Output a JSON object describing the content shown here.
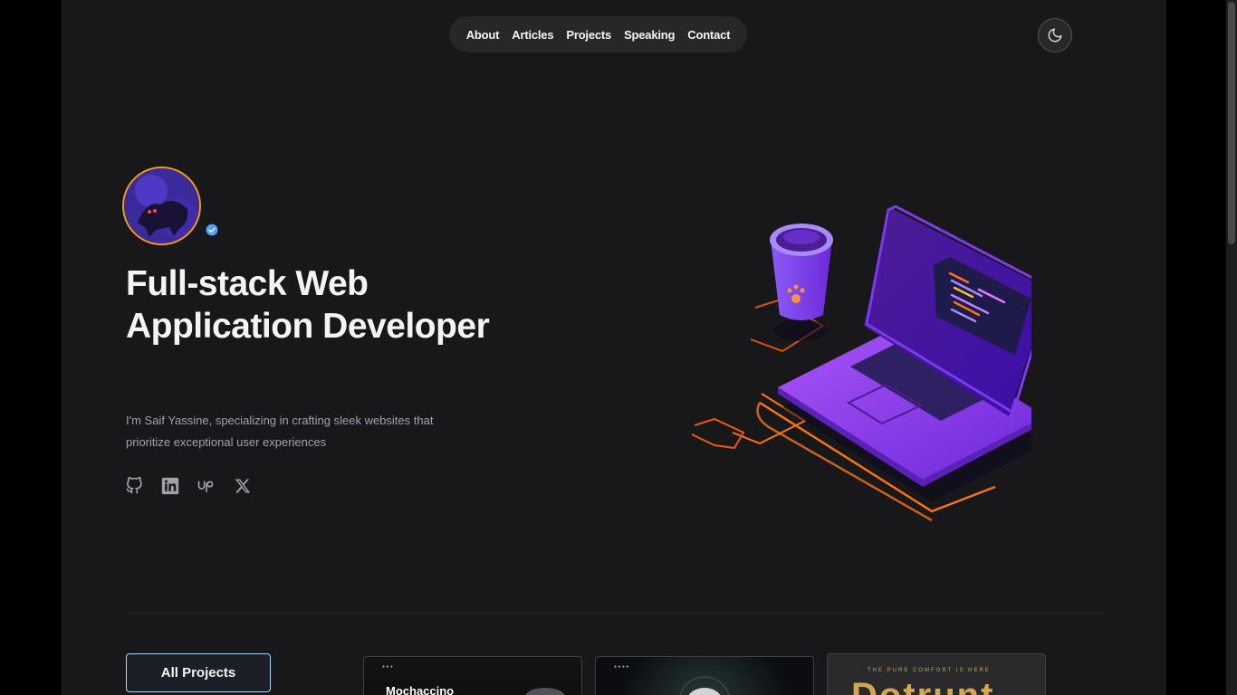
{
  "nav": {
    "items": [
      {
        "label": "About"
      },
      {
        "label": "Articles"
      },
      {
        "label": "Projects"
      },
      {
        "label": "Speaking"
      },
      {
        "label": "Contact"
      }
    ]
  },
  "theme_toggle": {
    "icon": "moon-icon"
  },
  "hero": {
    "title": "Full-stack Web Application Developer",
    "description": "I'm Saif Yassine, specializing in crafting sleek websites that prioritize exceptional user experiences",
    "socials": [
      {
        "name": "github-icon"
      },
      {
        "name": "linkedin-icon"
      },
      {
        "name": "upwork-icon"
      },
      {
        "name": "x-icon"
      }
    ]
  },
  "projects": {
    "all_label": "All Projects",
    "cards": [
      {
        "brand": "Mochaccino"
      },
      {
        "brand": ""
      },
      {
        "tag": "THE PURE COMFORT IS HERE",
        "big": "Dotrunt"
      }
    ]
  },
  "colors": {
    "background": "#18181b",
    "accent": "#f59e0b",
    "purple": "#7c3aed",
    "orange": "#f97316"
  }
}
